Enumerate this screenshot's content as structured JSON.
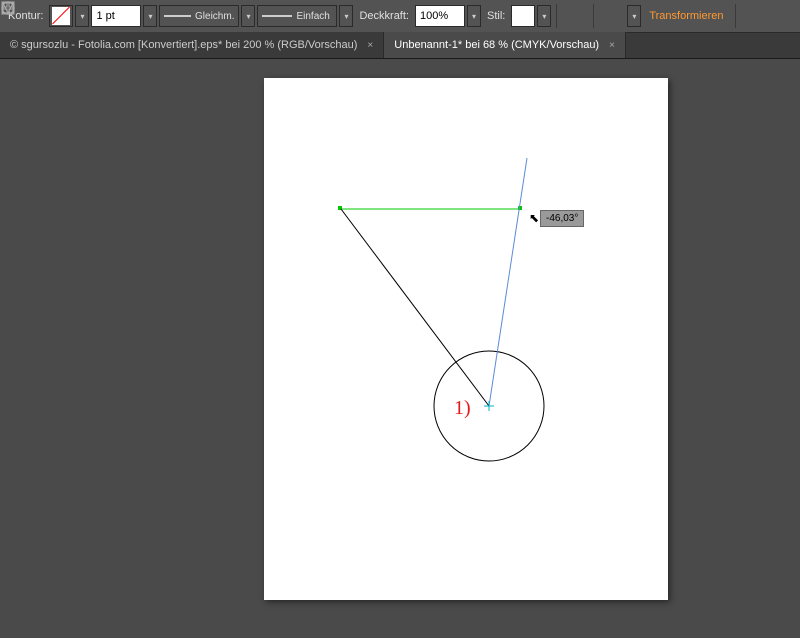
{
  "toolbar": {
    "stroke_label": "Kontur:",
    "stroke_weight": "1 pt",
    "stroke_type1": "Gleichm.",
    "stroke_type2": "Einfach",
    "opacity_label": "Deckkraft:",
    "opacity_value": "100%",
    "style_label": "Stil:",
    "transform_label": "Transformieren"
  },
  "tabs": {
    "tab1": "© sgursozlu - Fotolia.com [Konvertiert].eps* bei 200 % (RGB/Vorschau)",
    "tab2": "Unbenannt-1* bei 68 % (CMYK/Vorschau)"
  },
  "canvas": {
    "angle_readout": "-46,03°",
    "step_label": "1)"
  }
}
